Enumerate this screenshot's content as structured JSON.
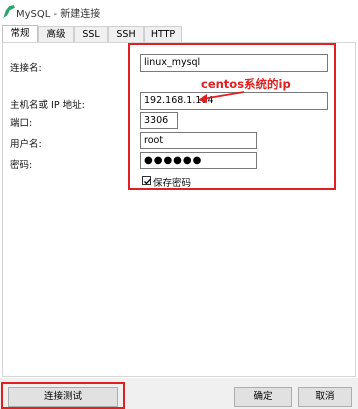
{
  "window": {
    "title": "MySQL - 新建连接"
  },
  "tabs": [
    {
      "label": "常规"
    },
    {
      "label": "高级"
    },
    {
      "label": "SSL"
    },
    {
      "label": "SSH"
    },
    {
      "label": "HTTP"
    }
  ],
  "form": {
    "connection_name_label": "连接名:",
    "connection_name_value": "linux_mysql",
    "host_label": "主机名或 IP 地址:",
    "host_value": "192.168.1.104",
    "port_label": "端口:",
    "port_value": "3306",
    "username_label": "用户名:",
    "username_value": "root",
    "password_label": "密码:",
    "password_value": "●●●●●●",
    "save_password_label": "保存密码",
    "save_password_checked": true
  },
  "annotation": {
    "text": "centos系统的ip",
    "color": "#e02020"
  },
  "footer": {
    "test_button": "连接测试",
    "ok_button": "确定",
    "cancel_button": "取消"
  }
}
